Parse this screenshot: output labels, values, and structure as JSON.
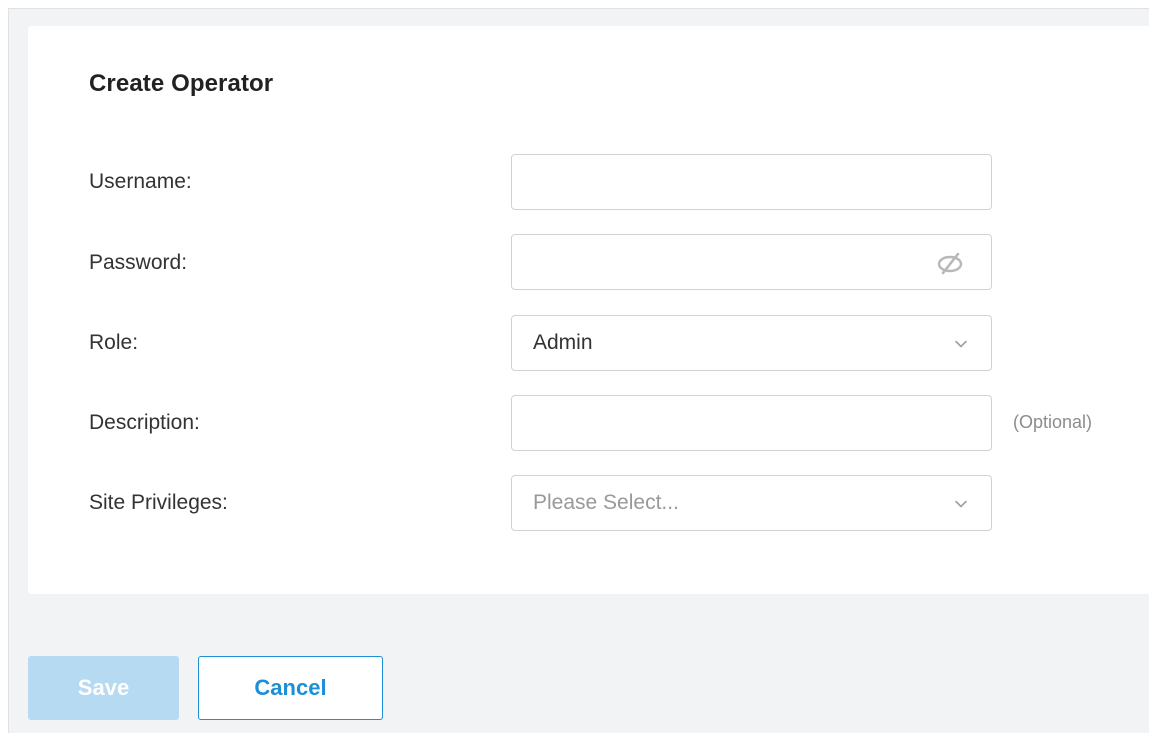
{
  "form": {
    "title": "Create Operator",
    "fields": {
      "username": {
        "label": "Username:",
        "value": ""
      },
      "password": {
        "label": "Password:",
        "value": "",
        "icon": "eye-slash-icon"
      },
      "role": {
        "label": "Role:",
        "selected": "Admin",
        "icon": "chevron-down-icon"
      },
      "description": {
        "label": "Description:",
        "value": "",
        "note": "(Optional)"
      },
      "site_privileges": {
        "label": "Site Privileges:",
        "placeholder": "Please Select...",
        "icon": "chevron-down-icon"
      }
    }
  },
  "actions": {
    "save_label": "Save",
    "cancel_label": "Cancel"
  },
  "colors": {
    "accent": "#1b8fd8",
    "save_disabled_bg": "#b5daf2",
    "page_bg": "#f2f3f5",
    "border": "#cfd3d8"
  }
}
